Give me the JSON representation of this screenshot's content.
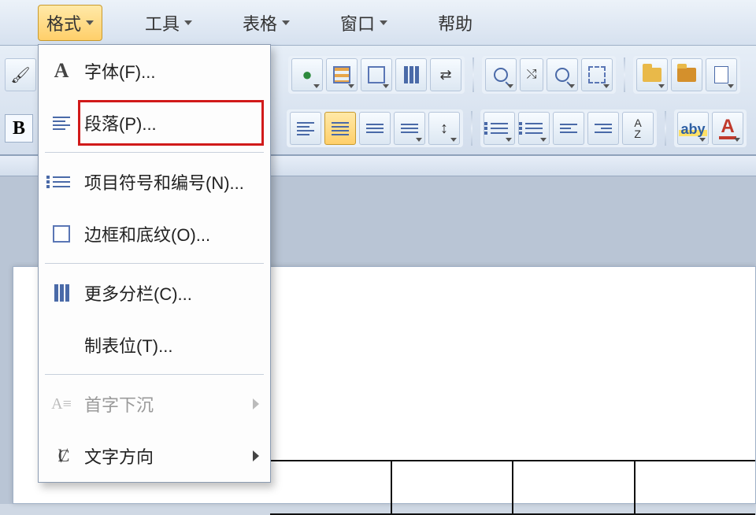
{
  "menubar": {
    "format": "格式",
    "tools": "工具",
    "table": "表格",
    "window": "窗口",
    "help": "帮助"
  },
  "dropdown": {
    "font": "字体(F)...",
    "paragraph": "段落(P)...",
    "bullets": "项目符号和编号(N)...",
    "borders": "边框和底纹(O)...",
    "columns": "更多分栏(C)...",
    "tabs": "制表位(T)...",
    "dropcap": "首字下沉",
    "textdir": "文字方向"
  },
  "bold_label": "B",
  "icons": {
    "A": "A",
    "aby": "aby",
    "az_top": "A",
    "az_bot": "Z"
  }
}
